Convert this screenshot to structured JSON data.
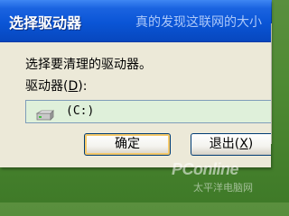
{
  "dialog": {
    "title": "选择驱动器",
    "prompt": "选择要清理的驱动器。",
    "drives_label": "驱动器",
    "drives_access_key": "D",
    "drives_label_suffix": "):",
    "selected_drive": "(C:)",
    "ok_label": "确定",
    "cancel_label_text": "退出",
    "cancel_access_key": "X"
  },
  "background_window": {
    "partial_title": "真的发现这联网的大小"
  },
  "watermark": {
    "brand": "PConline",
    "sub": "太平洋电脑网"
  },
  "colors": {
    "titlebar": "#0a55d6",
    "dialog_bg": "#ece9d8",
    "selected_row": "#dff0da",
    "desktop": "#4f8a34"
  }
}
